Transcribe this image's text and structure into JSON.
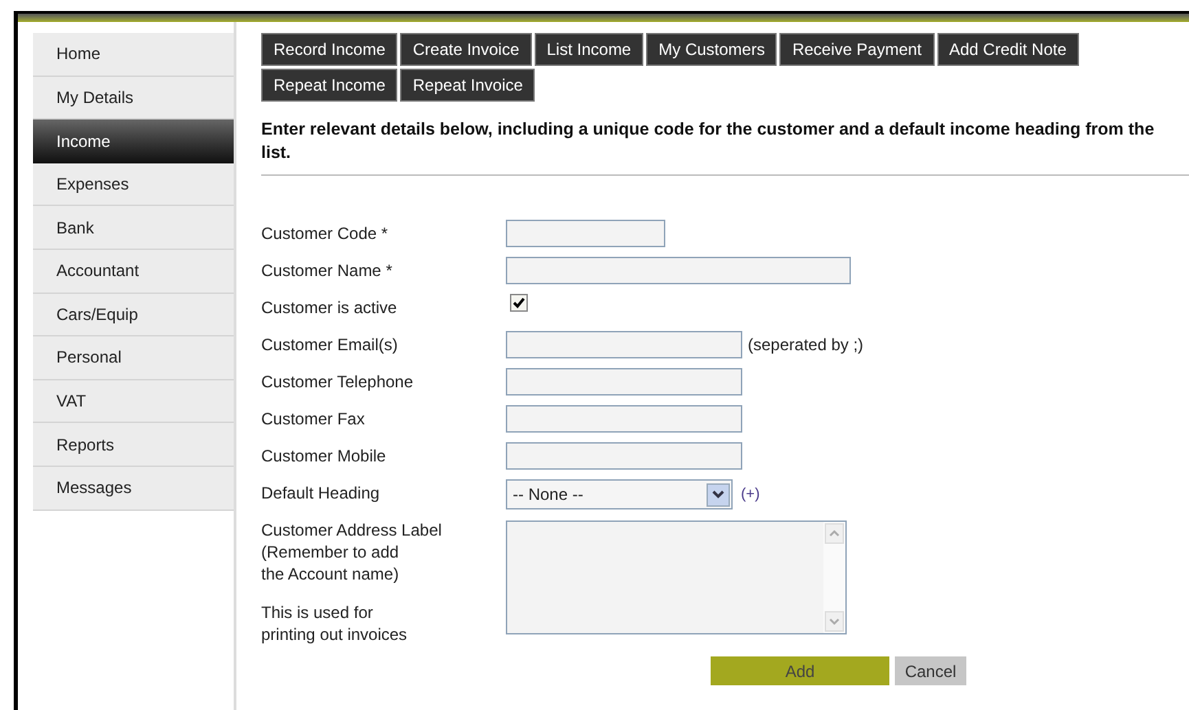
{
  "sidebar": {
    "items": [
      {
        "label": "Home",
        "selected": false
      },
      {
        "label": "My Details",
        "selected": false
      },
      {
        "label": "Income",
        "selected": true
      },
      {
        "label": "Expenses",
        "selected": false
      },
      {
        "label": "Bank",
        "selected": false
      },
      {
        "label": "Accountant",
        "selected": false
      },
      {
        "label": "Cars/Equip",
        "selected": false
      },
      {
        "label": "Personal",
        "selected": false
      },
      {
        "label": "VAT",
        "selected": false
      },
      {
        "label": "Reports",
        "selected": false
      },
      {
        "label": "Messages",
        "selected": false
      }
    ]
  },
  "subnav": [
    [
      "Record Income",
      "Create Invoice",
      "List Income",
      "My Customers",
      "Receive Payment",
      "Add Credit Note"
    ],
    [
      "Repeat Income",
      "Repeat Invoice"
    ]
  ],
  "instructions": "Enter relevant details below, including a unique code for the customer and a default income heading from the list.",
  "form": {
    "fields": [
      {
        "kind": "short_text",
        "label": "Customer Code *"
      },
      {
        "kind": "long_text",
        "label": "Customer Name *"
      },
      {
        "kind": "checkbox",
        "label": "Customer is active",
        "checked": true
      },
      {
        "kind": "text",
        "label": "Customer Email(s)",
        "note": "(seperated by ;)"
      },
      {
        "kind": "text",
        "label": "Customer Telephone"
      },
      {
        "kind": "text",
        "label": "Customer Fax"
      },
      {
        "kind": "text",
        "label": "Customer Mobile"
      },
      {
        "kind": "select",
        "label": "Default Heading",
        "value": "-- None --",
        "link": "(+)"
      },
      {
        "kind": "textarea",
        "label": "Customer Address Label\n(Remember to add\nthe Account name)",
        "hint": "This is used for\nprinting out invoices"
      }
    ],
    "buttons": [
      {
        "label": "Add",
        "kind": "primary"
      },
      {
        "label": "Cancel",
        "kind": "secondary"
      }
    ]
  }
}
